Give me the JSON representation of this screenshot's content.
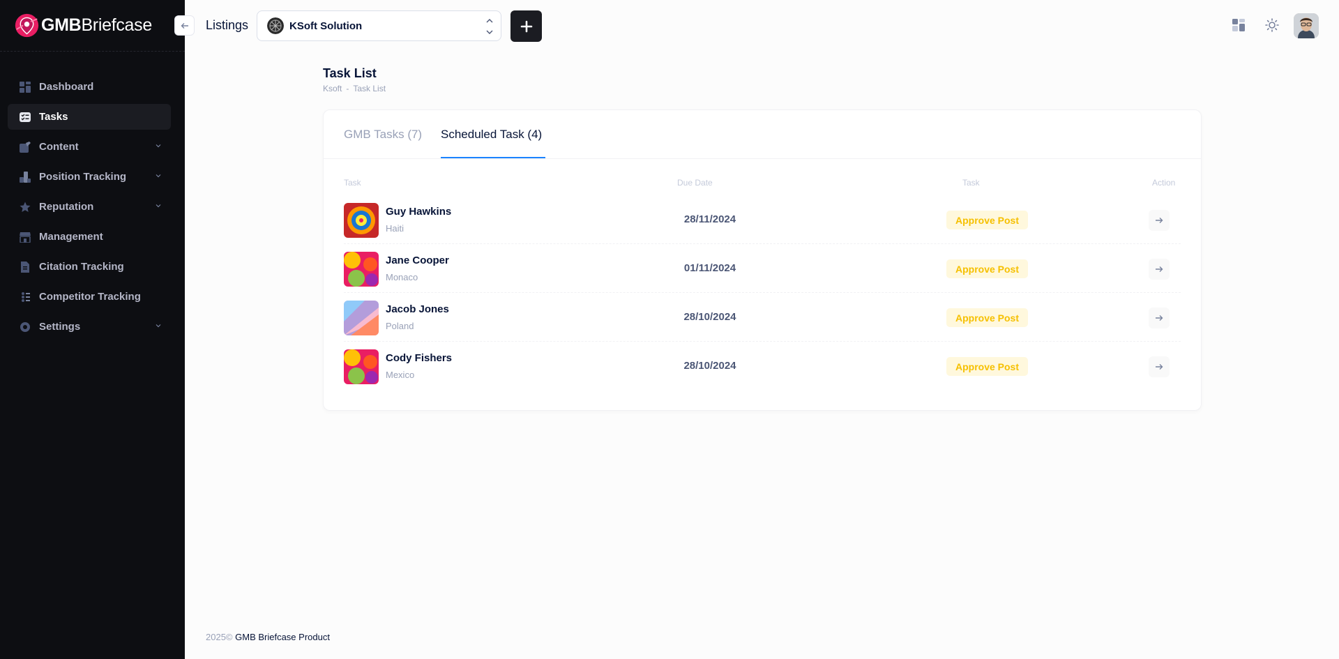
{
  "brand": {
    "bold": "GMB",
    "light": "Briefcase"
  },
  "sidebar": {
    "items": [
      {
        "label": "Dashboard",
        "icon": "dashboard-icon",
        "active": false,
        "expandable": false
      },
      {
        "label": "Tasks",
        "icon": "tasks-icon",
        "active": true,
        "expandable": false
      },
      {
        "label": "Content",
        "icon": "content-icon",
        "active": false,
        "expandable": true
      },
      {
        "label": "Position Tracking",
        "icon": "position-tracking-icon",
        "active": false,
        "expandable": true
      },
      {
        "label": "Reputation",
        "icon": "star-icon",
        "active": false,
        "expandable": true
      },
      {
        "label": "Management",
        "icon": "store-icon",
        "active": false,
        "expandable": false
      },
      {
        "label": "Citation Tracking",
        "icon": "document-icon",
        "active": false,
        "expandable": false
      },
      {
        "label": "Competitor Tracking",
        "icon": "competitor-icon",
        "active": false,
        "expandable": false
      },
      {
        "label": "Settings",
        "icon": "settings-icon",
        "active": false,
        "expandable": true
      }
    ]
  },
  "header": {
    "collapse_icon": "arrow-left-icon",
    "listings_label": "Listings",
    "selected_listing": "KSoft Solution",
    "add_icon": "plus-icon"
  },
  "page": {
    "title": "Task List",
    "breadcrumb": [
      "Ksoft",
      "-",
      "Task List"
    ]
  },
  "tabs": [
    {
      "label": "GMB Tasks (7)",
      "active": false
    },
    {
      "label": "Scheduled Task (4)",
      "active": true
    }
  ],
  "table": {
    "headers": [
      "Task",
      "Due Date",
      "Task",
      "Action"
    ],
    "rows": [
      {
        "name": "Guy Hawkins",
        "country": "Haiti",
        "due": "28/11/2024",
        "status": "Approve Post"
      },
      {
        "name": "Jane Cooper",
        "country": "Monaco",
        "due": "01/11/2024",
        "status": "Approve Post"
      },
      {
        "name": "Jacob Jones",
        "country": "Poland",
        "due": "28/10/2024",
        "status": "Approve Post"
      },
      {
        "name": "Cody Fishers",
        "country": "Mexico",
        "due": "28/10/2024",
        "status": "Approve Post"
      }
    ]
  },
  "footer": {
    "year": "2025©",
    "product": "GMB Briefcase Product"
  },
  "colors": {
    "accent": "#1b84ff",
    "sidebar_bg": "#0d0e12",
    "badge_bg": "#fff8dd",
    "badge_text": "#f6c000",
    "brand_pink": "#e91e63"
  }
}
